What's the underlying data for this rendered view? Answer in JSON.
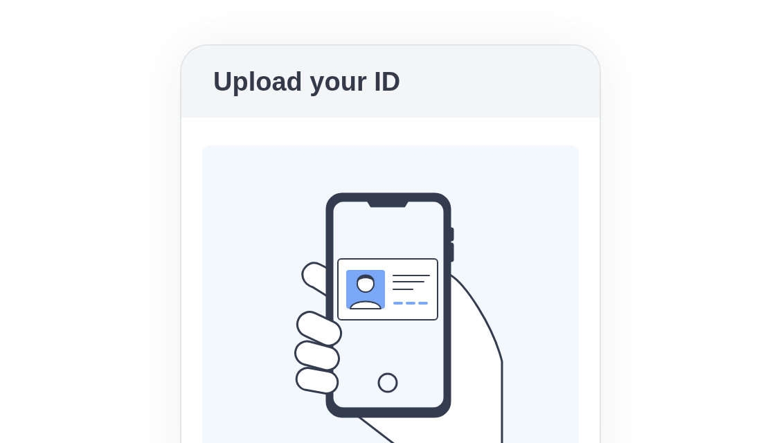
{
  "card": {
    "title": "Upload your ID"
  }
}
